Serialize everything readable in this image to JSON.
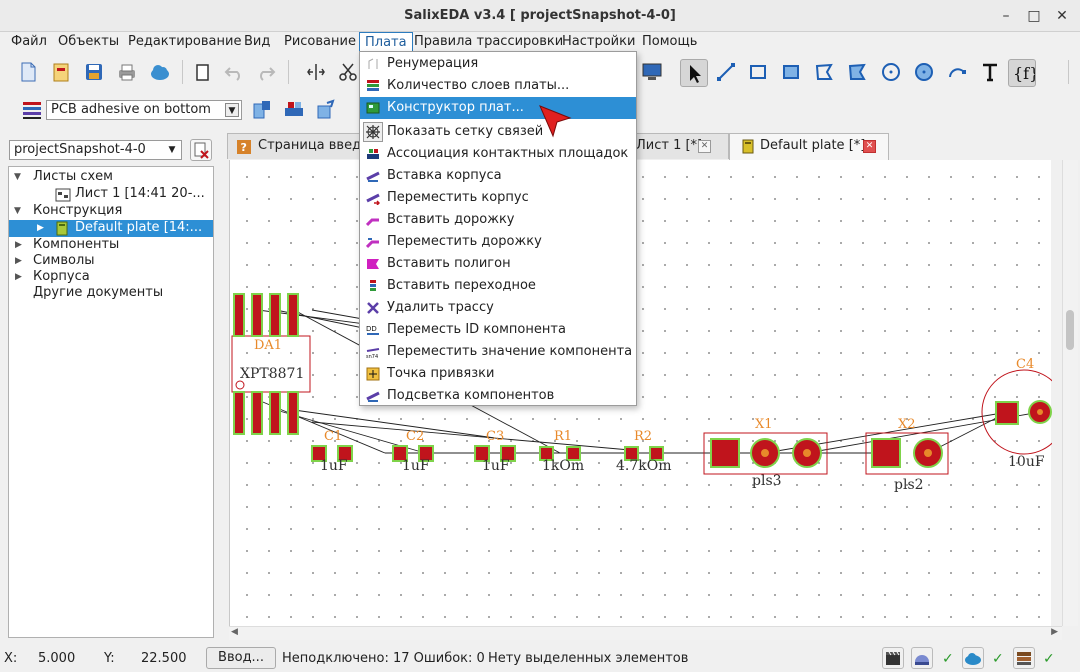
{
  "window": {
    "title": "SalixEDA v3.4 [ projectSnapshot-4-0]"
  },
  "menubar": [
    "Файл",
    "Объекты",
    "Редактирование",
    "Вид",
    "Рисование",
    "Плата",
    "Правила трассировки",
    "Настройки",
    "Помощь"
  ],
  "layer_combo": {
    "value": "PCB adhesive on bottom"
  },
  "project_combo": {
    "value": "projectSnapshot-4-0"
  },
  "tree": {
    "sheets": "Листы схем",
    "sheet1": "Лист 1 [14:41 20-...",
    "construction": "Конструкция",
    "plate": "Default plate [14:...",
    "components": "Компоненты",
    "symbols": "Символы",
    "packages": "Корпуса",
    "other": "Другие документы"
  },
  "tabs": {
    "start": "Страница введения",
    "sheet": "Лист 1 [*]",
    "plate": "Default plate [*]"
  },
  "plata_menu": [
    {
      "label": "Ренумерация",
      "icon": "renumber-icon"
    },
    {
      "label": "Количество слоев платы...",
      "icon": "layers-icon"
    },
    {
      "label": "Конструктор плат...",
      "icon": "board-constructor-icon",
      "highlighted": true
    },
    {
      "label": "Показать сетку связей",
      "icon": "ratsnest-icon"
    },
    {
      "label": "Ассоциация контактных площадок",
      "icon": "pad-association-icon"
    },
    {
      "label": "Вставка корпуса",
      "icon": "insert-package-icon"
    },
    {
      "label": "Переместить корпус",
      "icon": "move-package-icon"
    },
    {
      "label": "Вставить дорожку",
      "icon": "insert-track-icon"
    },
    {
      "label": "Переместить дорожку",
      "icon": "move-track-icon"
    },
    {
      "label": "Вставить полигон",
      "icon": "insert-polygon-icon"
    },
    {
      "label": "Вставить переходное",
      "icon": "insert-via-icon"
    },
    {
      "label": "Удалить трассу",
      "icon": "delete-trace-icon"
    },
    {
      "label": "Переместь ID компонента",
      "icon": "move-id-icon"
    },
    {
      "label": "Переместить значение компонента",
      "icon": "move-value-icon"
    },
    {
      "label": "Точка привязки",
      "icon": "anchor-point-icon"
    },
    {
      "label": "Подсветка компонентов",
      "icon": "highlight-components-icon"
    }
  ],
  "pcb": {
    "da1_ref": "DA1",
    "da1_value": "XPT8871",
    "c1_ref": "C1",
    "c1_value": "1uF",
    "c2_ref": "C2",
    "c2_value": "1uF",
    "c3_ref": "C3",
    "c3_value": "1uF",
    "r1_ref": "R1",
    "r1_value": "1kOm",
    "r2_ref": "R2",
    "r2_value": "4.7kOm",
    "x1_ref": "X1",
    "x1_value": "pls3",
    "x2_ref": "X2",
    "x2_value": "pls2",
    "c4_ref": "C4",
    "c4_value": "10uF"
  },
  "status": {
    "x_label": "X:",
    "x_value": "5.000",
    "y_label": "Y:",
    "y_value": "22.500",
    "input_button": "Ввод...",
    "summary": "Неподключено: 17 Ошибок: 0",
    "selection": "Нету выделенных элементов"
  },
  "colors": {
    "accent": "#2d8fd5",
    "pad_red": "#c0141c",
    "pad_green": "#7fd34a",
    "ref_orange": "#e8892a"
  }
}
